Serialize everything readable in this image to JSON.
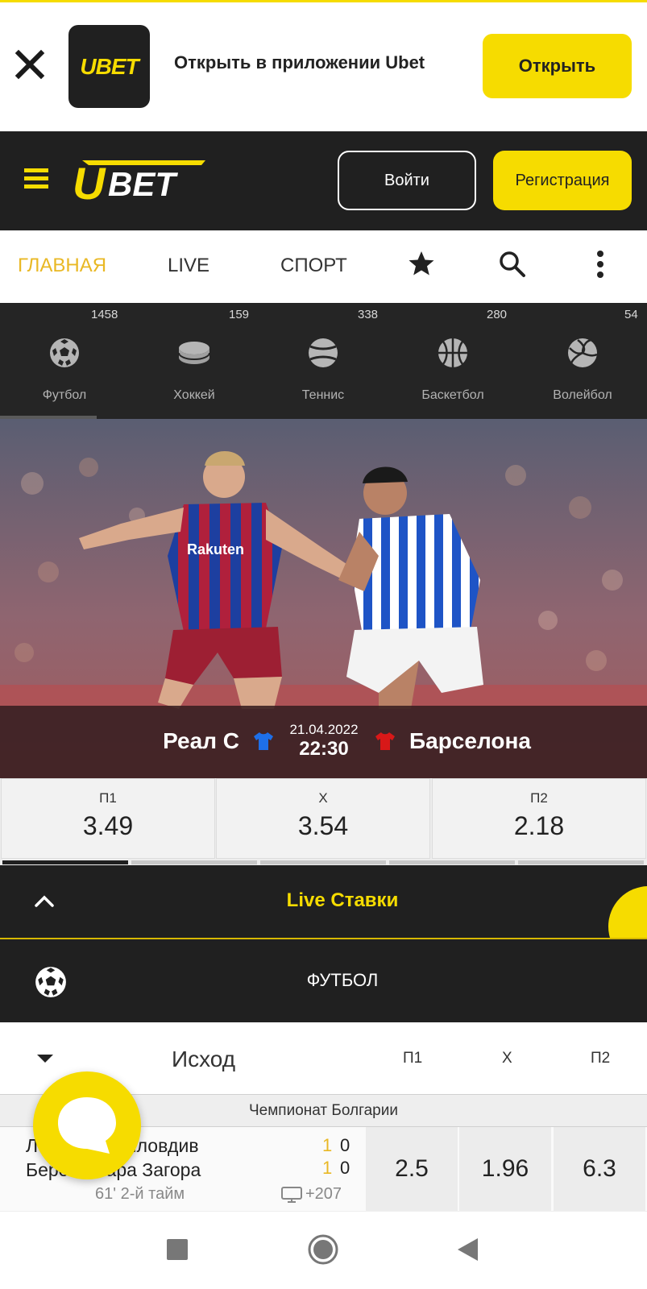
{
  "banner": {
    "app_logo_text": "UBET",
    "text": "Открыть в приложении Ubet",
    "open_label": "Открыть"
  },
  "header": {
    "logo_text": "UBET",
    "login_label": "Войти",
    "register_label": "Регистрация"
  },
  "nav": {
    "items": [
      "ГЛАВНАЯ",
      "LIVE",
      "СПОРТ"
    ],
    "active": "ГЛАВНАЯ"
  },
  "sports": [
    {
      "label": "Футбол",
      "count": "1458"
    },
    {
      "label": "Хоккей",
      "count": "159"
    },
    {
      "label": "Теннис",
      "count": "338"
    },
    {
      "label": "Баскетбол",
      "count": "280"
    },
    {
      "label": "Волейбол",
      "count": "54"
    }
  ],
  "featured": {
    "home": "Реал С",
    "away": "Барселона",
    "date": "21.04.2022",
    "time": "22:30",
    "home_shirt_color": "#1e6fe8",
    "away_shirt_color": "#d81818",
    "odds": [
      {
        "key": "П1",
        "value": "3.49"
      },
      {
        "key": "X",
        "value": "3.54"
      },
      {
        "key": "П2",
        "value": "2.18"
      }
    ]
  },
  "live": {
    "title": "Live Ставки",
    "sport_title": "ФУТБОЛ"
  },
  "market": {
    "title": "Исход",
    "cols": [
      "П1",
      "X",
      "П2"
    ]
  },
  "league": "Чемпионат Болгарии",
  "event": {
    "team1": "Локомотив Пловдив",
    "team2": "Берое Стара Загора",
    "score1": [
      "1",
      "0"
    ],
    "score2": [
      "1",
      "0"
    ],
    "status": "61' 2-й тайм",
    "more": "+207",
    "odds": [
      "2.5",
      "1.96",
      "6.3"
    ]
  },
  "colors": {
    "accent": "#f6dc00",
    "dark": "#202020",
    "active_nav": "#e9b824"
  }
}
